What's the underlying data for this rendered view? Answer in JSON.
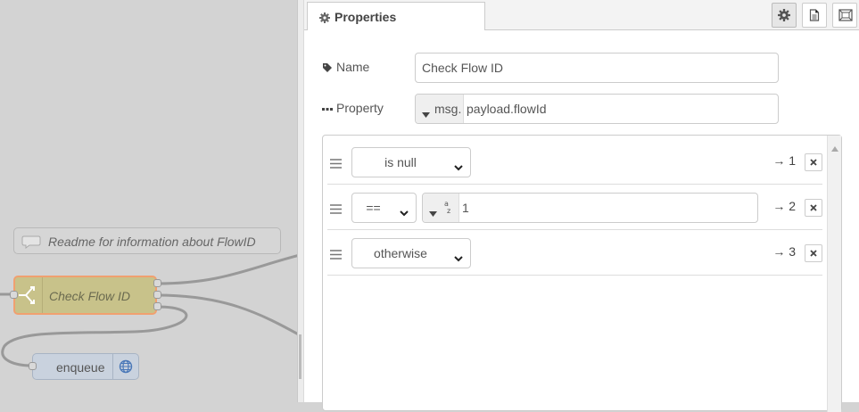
{
  "canvas": {
    "comment_node": {
      "label": "Readme for information about FlowID"
    },
    "switch_node": {
      "label": "Check Flow ID"
    },
    "enqueue_node": {
      "label": "enqueue"
    }
  },
  "panel": {
    "tab": {
      "label": "Properties",
      "icon": "gear-icon"
    },
    "toolbar": [
      {
        "name": "settings",
        "icon": "gear-icon",
        "active": true
      },
      {
        "name": "description",
        "icon": "file-icon",
        "active": false
      },
      {
        "name": "appearance",
        "icon": "frame-icon",
        "active": false
      }
    ],
    "name_field": {
      "label": "Name",
      "icon": "tag-icon",
      "value": "Check Flow ID"
    },
    "property_field": {
      "label": "Property",
      "icon": "ellipsis-icon",
      "type_prefix": "msg.",
      "value": "payload.flowId"
    },
    "rules": [
      {
        "operator": "is null",
        "value": null,
        "output": "→ 1"
      },
      {
        "operator": "==",
        "value_type_icon": "string-type-icon",
        "value": "1",
        "output": "→ 2"
      },
      {
        "operator": "otherwise",
        "value": null,
        "output": "→ 3"
      }
    ]
  }
}
